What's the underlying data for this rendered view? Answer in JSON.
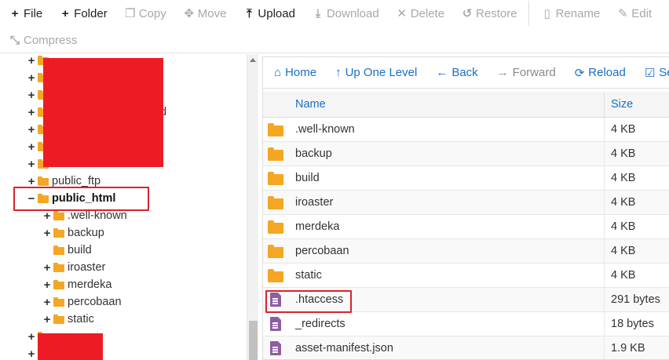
{
  "toolbar": {
    "row1": [
      {
        "name": "file-button",
        "icon": "plus-icon",
        "glyph": "+",
        "label": "File",
        "enabled": true
      },
      {
        "name": "folder-button",
        "icon": "plus-icon",
        "glyph": "+",
        "label": "Folder",
        "enabled": true
      },
      {
        "name": "copy-button",
        "icon": "copy-icon",
        "glyph": "❐",
        "label": "Copy",
        "enabled": false
      },
      {
        "name": "move-button",
        "icon": "move-icon",
        "glyph": "✥",
        "label": "Move",
        "enabled": false
      },
      {
        "name": "upload-button",
        "icon": "upload-icon",
        "glyph": "⤒",
        "label": "Upload",
        "enabled": true
      },
      {
        "name": "download-button",
        "icon": "download-icon",
        "glyph": "⤓",
        "label": "Download",
        "enabled": false
      },
      {
        "name": "delete-button",
        "icon": "close-icon",
        "glyph": "✕",
        "label": "Delete",
        "enabled": false
      },
      {
        "name": "restore-button",
        "icon": "undo-icon",
        "glyph": "↺",
        "label": "Restore",
        "enabled": false
      },
      {
        "name": "rename-button",
        "icon": "document-icon",
        "glyph": "▯",
        "label": "Rename",
        "enabled": false
      },
      {
        "name": "edit-button",
        "icon": "pencil-icon",
        "glyph": "✎",
        "label": "Edit",
        "enabled": false
      }
    ],
    "row2": [
      {
        "name": "compress-button",
        "icon": "compress-icon",
        "glyph": "⤡",
        "label": "Compress",
        "enabled": false
      }
    ]
  },
  "tree": {
    "top_rows": [
      {
        "text": "",
        "expander": "+"
      },
      {
        "text": "",
        "expander": "+"
      },
      {
        "text": "",
        "expander": "+"
      },
      {
        "text": "d",
        "expander": "+"
      },
      {
        "text": "",
        "expander": "+"
      },
      {
        "text": "",
        "expander": "+"
      },
      {
        "text": "",
        "expander": "+"
      },
      {
        "text": "public_ftp",
        "expander": "+"
      },
      {
        "text": "public_html",
        "expander": "−",
        "bold": true
      }
    ],
    "children": [
      {
        "text": ".well-known",
        "expander": "+"
      },
      {
        "text": "backup",
        "expander": "+"
      },
      {
        "text": "build",
        "expander": ""
      },
      {
        "text": "iroaster",
        "expander": "+"
      },
      {
        "text": "merdeka",
        "expander": "+"
      },
      {
        "text": "percobaan",
        "expander": "+"
      },
      {
        "text": "static",
        "expander": "+"
      }
    ],
    "bottom_rows": [
      {
        "text": "",
        "expander": "+"
      },
      {
        "text": "",
        "expander": "+"
      }
    ]
  },
  "nav": [
    {
      "name": "home-button",
      "icon": "home-icon",
      "glyph": "⌂",
      "label": "Home",
      "enabled": true
    },
    {
      "name": "up-one-level-button",
      "icon": "arrow-up-icon",
      "glyph": "↑",
      "label": "Up One Level",
      "enabled": true
    },
    {
      "name": "back-button",
      "icon": "arrow-left-icon",
      "glyph": "←",
      "label": "Back",
      "enabled": true
    },
    {
      "name": "forward-button",
      "icon": "arrow-right-icon",
      "glyph": "→",
      "label": "Forward",
      "enabled": false
    },
    {
      "name": "reload-button",
      "icon": "reload-icon",
      "glyph": "⟳",
      "label": "Reload",
      "enabled": true
    },
    {
      "name": "select-all-button",
      "icon": "checkbox-icon",
      "glyph": "☑",
      "label": "Sel",
      "enabled": true
    }
  ],
  "table": {
    "columns": {
      "name": "Name",
      "size": "Size"
    },
    "rows": [
      {
        "name": ".well-known",
        "size": "4 KB",
        "type": "folder"
      },
      {
        "name": "backup",
        "size": "4 KB",
        "type": "folder"
      },
      {
        "name": "build",
        "size": "4 KB",
        "type": "folder"
      },
      {
        "name": "iroaster",
        "size": "4 KB",
        "type": "folder"
      },
      {
        "name": "merdeka",
        "size": "4 KB",
        "type": "folder"
      },
      {
        "name": "percobaan",
        "size": "4 KB",
        "type": "folder"
      },
      {
        "name": "static",
        "size": "4 KB",
        "type": "folder"
      },
      {
        "name": ".htaccess",
        "size": "291 bytes",
        "type": "file"
      },
      {
        "name": "_redirects",
        "size": "18 bytes",
        "type": "file"
      },
      {
        "name": "asset-manifest.json",
        "size": "1.9 KB",
        "type": "file"
      }
    ]
  },
  "colors": {
    "accent": "#1a6fc2",
    "folder": "#f5a623",
    "file": "#8e5ea2",
    "highlight": "#d9232d",
    "redaction": "#ed1c24"
  }
}
